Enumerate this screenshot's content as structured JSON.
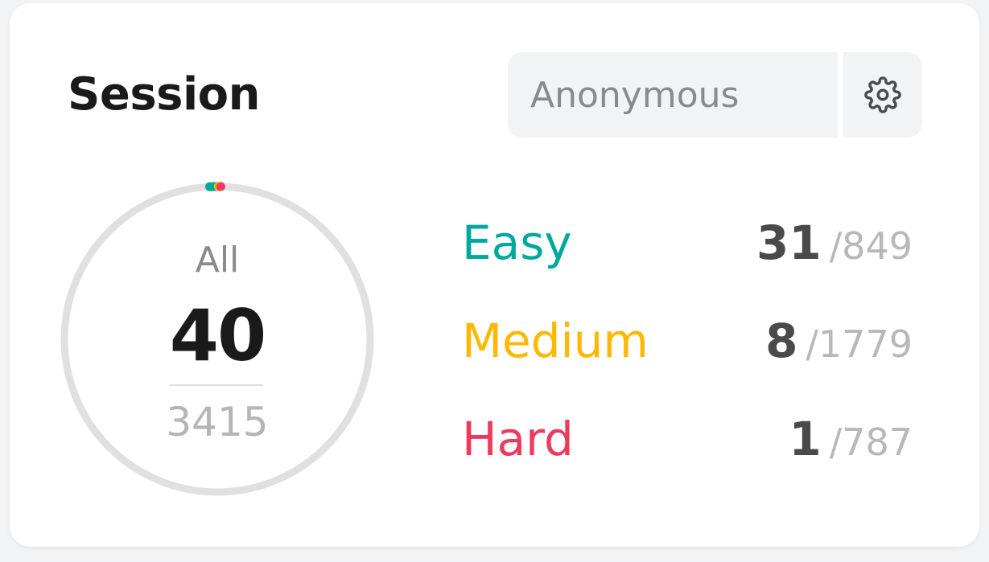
{
  "header": {
    "title": "Session",
    "session_value": "Anonymous",
    "settings_icon": "gear-icon"
  },
  "summary": {
    "label": "All",
    "solved": "40",
    "total": "3415",
    "ring_track_color": "#e0e0e0"
  },
  "difficulties": [
    {
      "label": "Easy",
      "solved": "31",
      "total": "/849",
      "color": "#00a99d"
    },
    {
      "label": "Medium",
      "solved": "8",
      "total": "/1779",
      "color": "#ffb800"
    },
    {
      "label": "Hard",
      "solved": "1",
      "total": "/787",
      "color": "#ef3a5d"
    }
  ]
}
